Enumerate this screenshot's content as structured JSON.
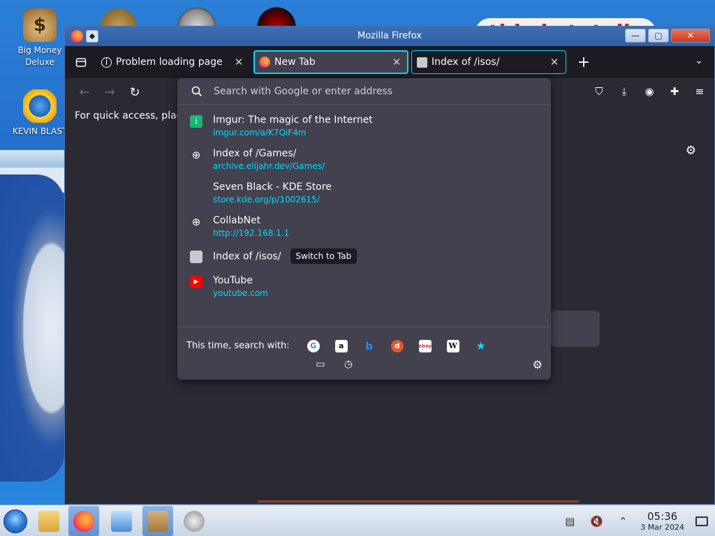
{
  "desktop": {
    "icons": [
      {
        "label": "Big Money Deluxe"
      },
      {
        "label": "KEVIN BLAST"
      }
    ],
    "wallpaper_text": "this is totally"
  },
  "window": {
    "title": "Mozilla Firefox",
    "buttons": {
      "minimize": "—",
      "maximize": "▢",
      "close": "✕"
    }
  },
  "tabs": [
    {
      "label": "Problem loading page",
      "icon": "info-icon",
      "state": "normal"
    },
    {
      "label": "New Tab",
      "icon": "firefox-icon",
      "state": "active"
    },
    {
      "label": "Index of /isos/",
      "icon": "server-icon",
      "state": "boxed"
    }
  ],
  "bookmarks_bar": {
    "text": "For quick access, plac"
  },
  "urlbar": {
    "placeholder": "Search with Google or enter address",
    "results": [
      {
        "title": "Imgur: The magic of the Internet",
        "url": "imgur.com/a/K7QiF4m",
        "icon": "imgur-icon"
      },
      {
        "title": "Index of /Games/",
        "url": "archive.elijahr.dev/Games/",
        "icon": "globe-icon"
      },
      {
        "title": "Seven Black - KDE Store",
        "url": "store.kde.org/p/1002615/",
        "icon": "kde-store-icon"
      },
      {
        "title": "CollabNet",
        "url": "http://192.168.1.1",
        "icon": "globe-icon"
      },
      {
        "title": "Index of /isos/",
        "action": "Switch to Tab",
        "icon": "server-icon"
      },
      {
        "title": "YouTube",
        "url": "youtube.com",
        "icon": "youtube-icon"
      }
    ],
    "one_offs_label": "This time, search with:",
    "engines": [
      "google-icon",
      "amazon-icon",
      "bing-icon",
      "duckduckgo-icon",
      "ebay-icon",
      "wikipedia-icon",
      "bookmarks-star-icon"
    ],
    "modes": [
      "tabs-icon",
      "history-icon"
    ]
  },
  "taskbar": {
    "clock_time": "05:36",
    "clock_date": "3 Mar 2024"
  },
  "colors": {
    "accent": "#00ddff",
    "popup_bg": "#42414d",
    "toolbar_bg": "#2b2a33",
    "tab_bar_bg": "#1c1b22"
  }
}
